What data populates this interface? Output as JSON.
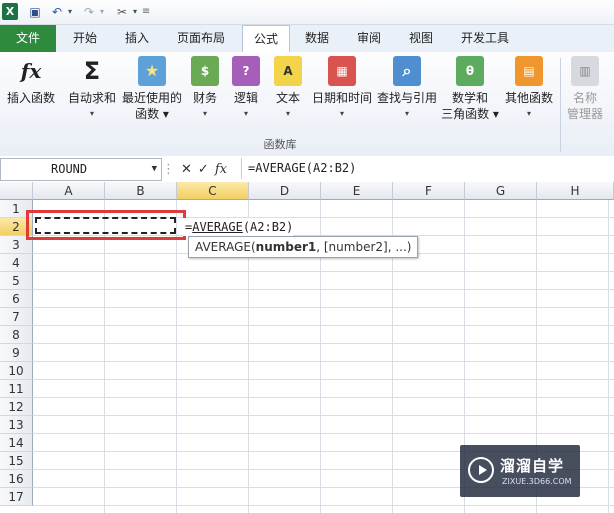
{
  "qat": {
    "logo": "X",
    "save_icon": "save-icon",
    "undo_icon": "undo-icon",
    "redo_icon": "redo-icon",
    "tools_icon": "tools-icon"
  },
  "tabs": [
    {
      "label": "文件"
    },
    {
      "label": "开始"
    },
    {
      "label": "插入"
    },
    {
      "label": "页面布局"
    },
    {
      "label": "公式"
    },
    {
      "label": "数据"
    },
    {
      "label": "审阅"
    },
    {
      "label": "视图"
    },
    {
      "label": "开发工具"
    }
  ],
  "ribbon": {
    "buttons": [
      {
        "line1": "插入函数",
        "line2": "",
        "icon": "fx"
      },
      {
        "line1": "自动求和",
        "line2": "▾",
        "icon": "Σ"
      },
      {
        "line1": "最近使用的",
        "line2": "函数 ▾",
        "icon": "★"
      },
      {
        "line1": "财务",
        "line2": "▾",
        "icon": "$"
      },
      {
        "line1": "逻辑",
        "line2": "▾",
        "icon": "?"
      },
      {
        "line1": "文本",
        "line2": "▾",
        "icon": "A"
      },
      {
        "line1": "日期和时间",
        "line2": "▾",
        "icon": "▦"
      },
      {
        "line1": "查找与引用",
        "line2": "▾",
        "icon": "⌕"
      },
      {
        "line1": "数学和",
        "line2": "三角函数 ▾",
        "icon": "θ"
      },
      {
        "line1": "其他函数",
        "line2": "▾",
        "icon": "▤"
      },
      {
        "line1": "名称",
        "line2": "管理器",
        "icon": "▥"
      }
    ],
    "group_label": "函数库"
  },
  "formula_bar": {
    "name_box": "ROUND",
    "cancel": "✕",
    "enter": "✓",
    "fx": "fx",
    "formula": "=AVERAGE(A2:B2)"
  },
  "grid": {
    "columns": [
      "A",
      "B",
      "C",
      "D",
      "E",
      "F",
      "G",
      "H"
    ],
    "rows": [
      "1",
      "2",
      "3",
      "4",
      "5",
      "6",
      "7",
      "8",
      "9",
      "10",
      "11",
      "12",
      "13",
      "14",
      "15",
      "16",
      "17"
    ],
    "active_column": "C",
    "active_row": "2",
    "editing_cell": {
      "prefix": "=",
      "function": "AVERAGE",
      "args": "(A2:B2)"
    },
    "tooltip": {
      "fn": "AVERAGE(",
      "arg1": "number1",
      "rest": ", [number2], ...)"
    }
  },
  "watermark": {
    "title": "溜溜自学",
    "subtitle": "ZIXUE.3D66.COM"
  }
}
